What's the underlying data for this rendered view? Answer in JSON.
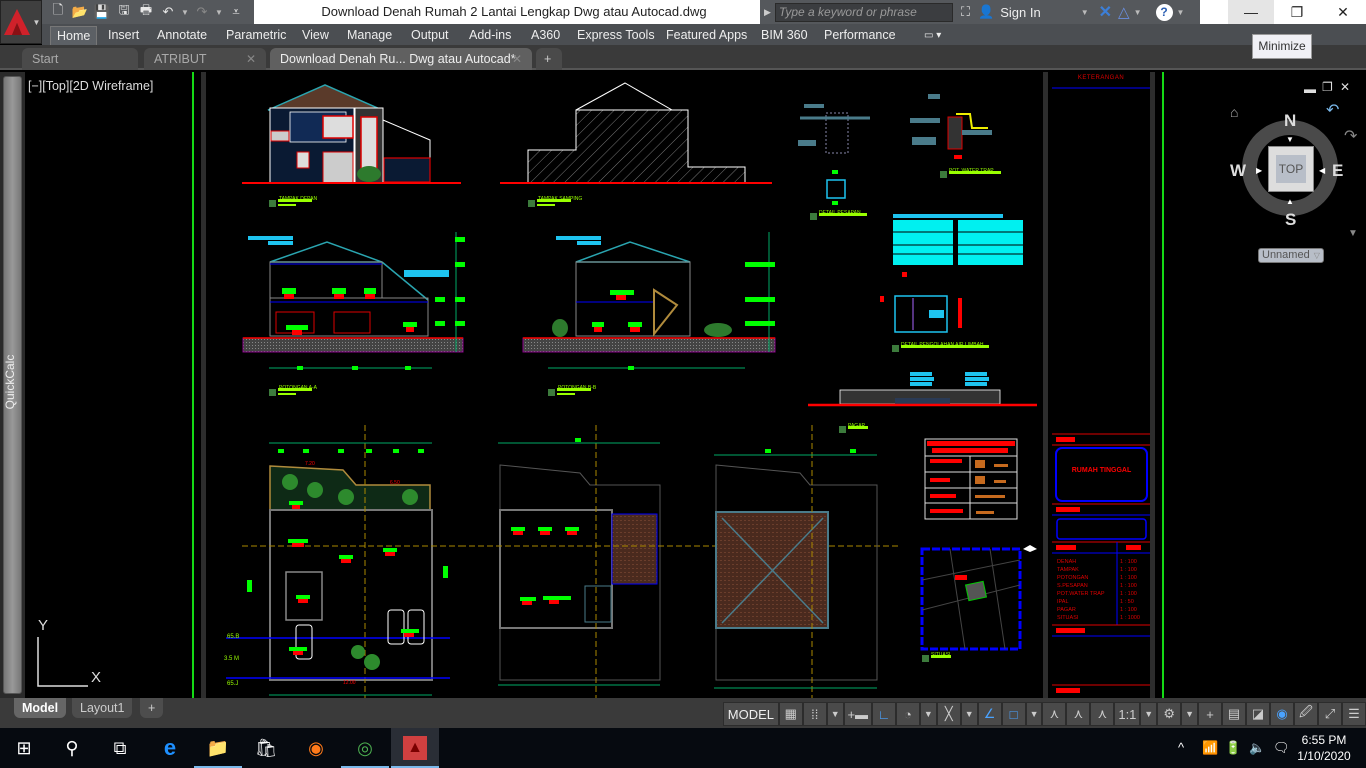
{
  "app": {
    "window_title": "Download Denah Rumah 2 Lantai Lengkap Dwg atau Autocad.dwg",
    "search_placeholder": "Type a keyword or phrase",
    "sign_in": "Sign In",
    "tooltip": "Minimize"
  },
  "quick_access": [
    {
      "icon": "new-icon"
    },
    {
      "icon": "open-icon"
    },
    {
      "icon": "save-icon"
    },
    {
      "icon": "save-as-icon"
    },
    {
      "icon": "plot-icon"
    },
    {
      "icon": "undo-icon"
    },
    {
      "icon": "redo-icon"
    },
    {
      "icon": "customize-icon"
    }
  ],
  "ribbon_tabs": [
    {
      "label": "Home",
      "active": true
    },
    {
      "label": "Insert"
    },
    {
      "label": "Annotate"
    },
    {
      "label": "Parametric"
    },
    {
      "label": "View"
    },
    {
      "label": "Manage"
    },
    {
      "label": "Output"
    },
    {
      "label": "Add-ins"
    },
    {
      "label": "A360"
    },
    {
      "label": "Express Tools"
    },
    {
      "label": "Featured Apps"
    },
    {
      "label": "BIM 360"
    },
    {
      "label": "Performance"
    }
  ],
  "file_tabs": [
    {
      "label": "Start"
    },
    {
      "label": "ATRIBUT"
    },
    {
      "label": "Download Denah Ru... Dwg atau Autocad*",
      "active": true
    }
  ],
  "palette": {
    "label": "QuickCalc"
  },
  "viewport": {
    "label": "[−][Top][2D Wireframe]",
    "ucs_x": "X",
    "ucs_y": "Y"
  },
  "viewcube": {
    "face": "TOP",
    "north": "N",
    "south": "S",
    "east": "E",
    "west": "W",
    "ucs_menu": "Unnamed"
  },
  "title_block": {
    "header": "KETERANGAN",
    "project": "RUMAH TINGGAL",
    "scales": [
      {
        "item": "DENAH",
        "scale": "1 : 100"
      },
      {
        "item": "TAMPAK",
        "scale": "1 : 100"
      },
      {
        "item": "POTONGAN",
        "scale": "1 : 100"
      },
      {
        "item": "S.PESAPAN",
        "scale": "1 : 100"
      },
      {
        "item": "POT.WATER TRAP",
        "scale": "1 : 100"
      },
      {
        "item": "IPAL",
        "scale": "1 : 50"
      },
      {
        "item": "PAGAR",
        "scale": "1 : 100"
      },
      {
        "item": "SITUASI",
        "scale": "1 : 1000"
      }
    ]
  },
  "drawing_labels": {
    "front_elevation": "TAMPAK DEPAN",
    "side_elevation": "TAMPAK SAMPING",
    "section_a": "POTONGAN A-A",
    "section_b": "POTONGAN B-B",
    "foundation": "DETAIL PESAPAN",
    "water_trap": "POT. WATER TRAP",
    "ipal": "DETAIL PENGOLAHAN AIR LIMBAH",
    "fence": "PAGAR",
    "situation": "SITUASI",
    "dim_720": "7.20",
    "dim_650": "6.50",
    "dim_1200": "12.00",
    "level_65b": "65.B",
    "level_35m": "3.5 M",
    "level_65j": "65.J"
  },
  "layout_tabs": [
    {
      "label": "Model",
      "active": true
    },
    {
      "label": "Layout1"
    },
    {
      "label": "+"
    }
  ],
  "statusbar": {
    "model": "MODEL",
    "scale": "1:1",
    "items": [
      "grid-icon",
      "snap-icon",
      "dropdown",
      "dynamic-input-icon",
      "ortho-icon",
      "polar-icon",
      "dropdown",
      "isodraft-icon",
      "dropdown",
      "osnap-track-icon",
      "osnap-icon",
      "dropdown",
      "annotation-visibility-icon",
      "auto-scale-icon",
      "annotation-scale-icon",
      "scale",
      "dropdown",
      "workspace-gear-icon",
      "dropdown",
      "annotation-monitor-icon",
      "units-icon",
      "quick-properties-icon",
      "isolate-icon",
      "hardware-accel-icon",
      "clean-screen-icon",
      "customize-icon"
    ]
  },
  "taskbar": {
    "apps": [
      "start-icon",
      "search-icon",
      "task-view-icon",
      "edge-icon",
      "file-explorer-icon",
      "store-icon",
      "firefox-icon",
      "chrome-icon",
      "autocad-icon"
    ],
    "time": "6:55 PM",
    "date": "1/10/2020"
  },
  "colors": {
    "cad_green": "#00ff00",
    "cad_red": "#ff0000",
    "cad_blue": "#0000ff",
    "cad_cyan": "#00ffff",
    "ribbon_bg": "#4b4e52",
    "viewport_bg": "#000000"
  }
}
